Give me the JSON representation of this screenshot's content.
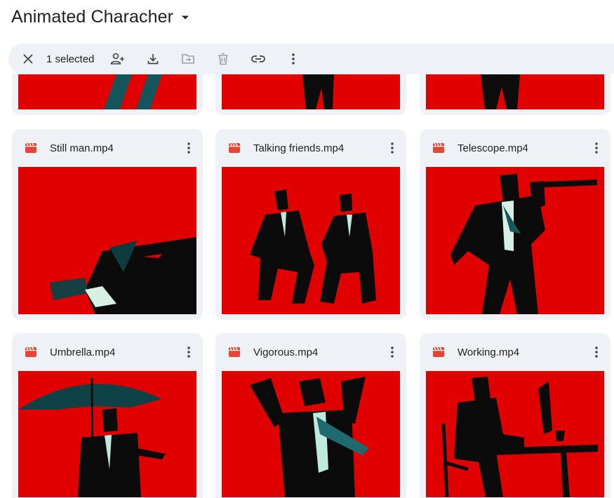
{
  "header": {
    "title": "Animated Characher"
  },
  "toolbar": {
    "selected_label": "1 selected"
  },
  "colors": {
    "accent_red": "#e00000",
    "card_bg": "#eef1f6",
    "icon_red": "#ea4335"
  },
  "files": [
    {
      "name": "Still man.mp4"
    },
    {
      "name": "Talking friends.mp4"
    },
    {
      "name": "Telescope.mp4"
    },
    {
      "name": "Umbrella.mp4"
    },
    {
      "name": "Vigorous.mp4"
    },
    {
      "name": "Working.mp4"
    }
  ]
}
